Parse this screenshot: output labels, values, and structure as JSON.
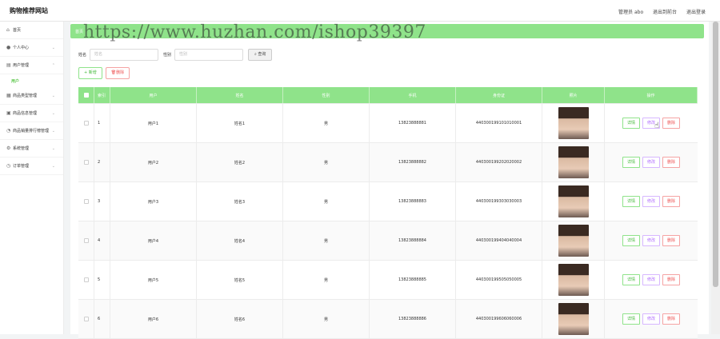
{
  "header": {
    "brand": "购物推荐网站",
    "admin_label": "管理员 abo",
    "back_label": "退出到前台",
    "logout_label": "退出登录"
  },
  "watermark": "https://www.huzhan.com/ishop39397",
  "sidebar": {
    "items": [
      {
        "label": "首页",
        "icon": "home-icon"
      },
      {
        "label": "个人中心",
        "icon": "user-icon"
      },
      {
        "label": "用户管理",
        "icon": "folder-icon"
      },
      {
        "label": "商品类型管理",
        "icon": "image-icon"
      },
      {
        "label": "商品信息管理",
        "icon": "grid-icon"
      },
      {
        "label": "商品销量排行榜管理",
        "icon": "chat-icon"
      },
      {
        "label": "系统管理",
        "icon": "gear-icon"
      },
      {
        "label": "订单管理",
        "icon": "clock-icon"
      }
    ],
    "active_sub": "用户"
  },
  "breadcrumb": "首页",
  "search": {
    "name_label": "姓名",
    "name_placeholder": "姓名",
    "sex_label": "性别",
    "sex_placeholder": "性别",
    "button": "查询"
  },
  "actions": {
    "add": "+ 新增",
    "delete": "删除"
  },
  "table": {
    "headers": [
      "索引",
      "用户",
      "姓名",
      "性别",
      "手机",
      "身份证",
      "照片",
      "操作"
    ],
    "rows": [
      {
        "idx": "1",
        "user": "用户1",
        "name": "姓名1",
        "sex": "男",
        "phone": "13823888881",
        "idcard": "440300199101010001"
      },
      {
        "idx": "2",
        "user": "用户2",
        "name": "姓名2",
        "sex": "男",
        "phone": "13823888882",
        "idcard": "440300199202020002"
      },
      {
        "idx": "3",
        "user": "用户3",
        "name": "姓名3",
        "sex": "男",
        "phone": "13823888883",
        "idcard": "440300199303030003"
      },
      {
        "idx": "4",
        "user": "用户4",
        "name": "姓名4",
        "sex": "男",
        "phone": "13823888884",
        "idcard": "440300199404040004"
      },
      {
        "idx": "5",
        "user": "用户5",
        "name": "姓名5",
        "sex": "男",
        "phone": "13823888885",
        "idcard": "440300199505050005"
      },
      {
        "idx": "6",
        "user": "用户6",
        "name": "姓名6",
        "sex": "男",
        "phone": "13823888886",
        "idcard": "440300199606060006"
      }
    ],
    "ops": {
      "view": "详情",
      "edit": "修改",
      "del": "删除"
    }
  },
  "colors": {
    "accent": "#8fe38a",
    "danger": "#ee5555",
    "edit": "#b06bff"
  }
}
